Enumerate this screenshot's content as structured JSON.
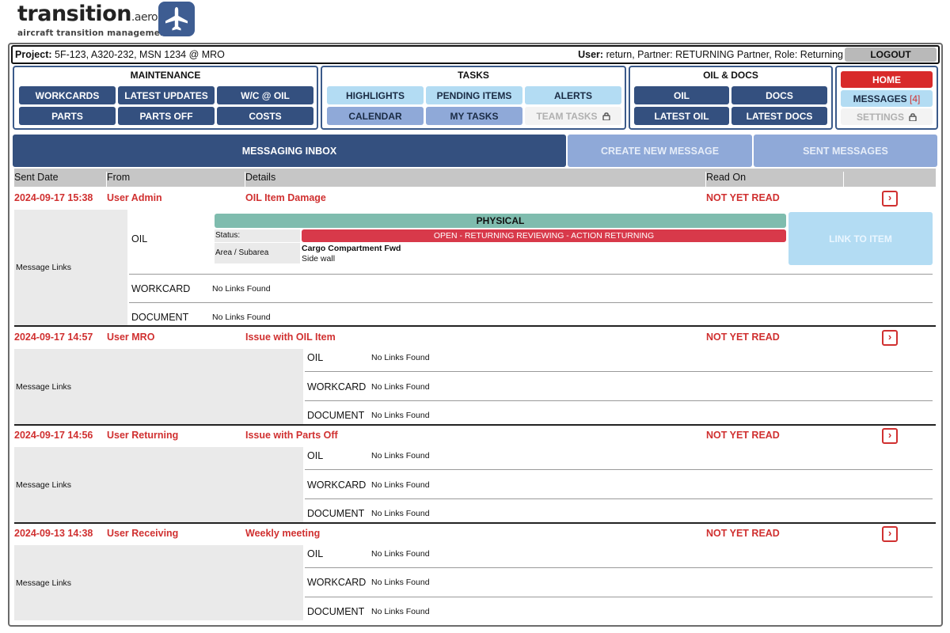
{
  "logo": {
    "word": "transition",
    "aero": ".aero",
    "tagline": "aircraft transition management"
  },
  "projectbar": {
    "project_label": "Project:",
    "project_value": "5F-123, A320-232, MSN 1234 @ MRO",
    "user_label": "User:",
    "user_value": "return, Partner: RETURNING Partner, Role: Returning",
    "logout": "LOGOUT"
  },
  "maintenance": {
    "title": "MAINTENANCE",
    "items": [
      "WORKCARDS",
      "LATEST UPDATES",
      "W/C @ OIL",
      "PARTS",
      "PARTS OFF",
      "COSTS"
    ]
  },
  "tasks": {
    "title": "TASKS",
    "items": [
      "HIGHLIGHTS",
      "PENDING ITEMS",
      "ALERTS",
      "CALENDAR",
      "MY TASKS",
      "TEAM TASKS"
    ]
  },
  "oildocs": {
    "title": "OIL & DOCS",
    "items": [
      "OIL",
      "DOCS",
      "LATEST OIL",
      "LATEST DOCS"
    ]
  },
  "side": {
    "home": "HOME",
    "messages": "MESSAGES",
    "messages_count": "[4]",
    "settings": "SETTINGS"
  },
  "inbox_tabs": [
    "MESSAGING INBOX",
    "CREATE NEW MESSAGE",
    "SENT MESSAGES"
  ],
  "table_headers": [
    "Sent Date",
    "From",
    "Details",
    "Read On"
  ],
  "message_links_label": "Message Links",
  "link_labels": [
    "OIL",
    "WORKCARD",
    "DOCUMENT"
  ],
  "no_links": "No Links Found",
  "oil_detail": {
    "category": "PHYSICAL",
    "status_label": "Status:",
    "status_value": "OPEN - RETURNING REVIEWING - ACTION RETURNING",
    "area_label": "Area / Subarea",
    "area_value": "Cargo Compartment Fwd",
    "subarea_value": "Side wall",
    "link_button": "LINK TO ITEM"
  },
  "messages": [
    {
      "date": "2024-09-17 15:38",
      "from": "User Admin",
      "details": "OIL Item Damage",
      "read_on": "NOT YET READ"
    },
    {
      "date": "2024-09-17 14:57",
      "from": "User MRO",
      "details": "Issue with OIL Item",
      "read_on": "NOT YET READ"
    },
    {
      "date": "2024-09-17 14:56",
      "from": "User Returning",
      "details": "Issue with Parts Off",
      "read_on": "NOT YET READ"
    },
    {
      "date": "2024-09-13 14:38",
      "from": "User Receiving",
      "details": "Weekly meeting",
      "read_on": "NOT YET READ"
    }
  ],
  "colors": {
    "navy": "#34507f",
    "light_blue": "#b3dcf3",
    "red": "#d03030",
    "teal": "#7fbcae"
  }
}
